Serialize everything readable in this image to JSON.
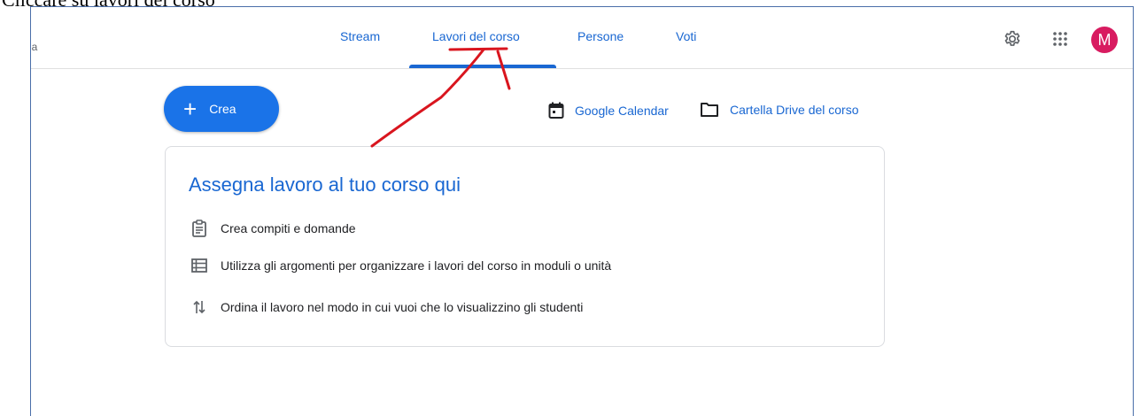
{
  "caption": "Cliccare su lavori del corso",
  "left_fragment": "ia",
  "tabs": [
    {
      "label": "Stream"
    },
    {
      "label": "Lavori del corso"
    },
    {
      "label": "Persone"
    },
    {
      "label": "Voti"
    }
  ],
  "user": {
    "avatar_initial": "M"
  },
  "create_button": {
    "label": "Crea"
  },
  "links": {
    "calendar": "Google Calendar",
    "drive": "Cartella Drive del corso"
  },
  "card": {
    "title": "Assegna lavoro al tuo corso qui",
    "items": [
      {
        "icon": "assignment-icon",
        "text": "Crea compiti e domande"
      },
      {
        "icon": "topic-list-icon",
        "text": "Utilizza gli argomenti per organizzare i lavori del corso in moduli o unità"
      },
      {
        "icon": "reorder-arrows-icon",
        "text": "Ordina il lavoro nel modo in cui vuoi che lo visualizzino gli studenti"
      }
    ]
  },
  "colors": {
    "accent": "#1a73e8",
    "link": "#1967d2",
    "avatar": "#d81b60",
    "annotation": "#d9151e"
  }
}
